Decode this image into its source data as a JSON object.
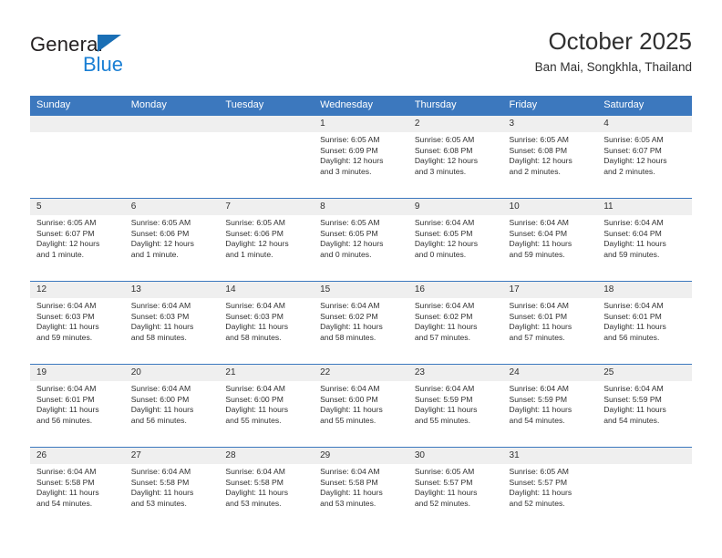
{
  "logo": {
    "word1": "General",
    "word2": "Blue",
    "triangle_color": "#1a6fb5",
    "blue_color": "#1a7fd4"
  },
  "header": {
    "title": "October 2025",
    "subtitle": "Ban Mai, Songkhla, Thailand",
    "accent_color": "#3c78be"
  },
  "calendar": {
    "weekdays": [
      "Sunday",
      "Monday",
      "Tuesday",
      "Wednesday",
      "Thursday",
      "Friday",
      "Saturday"
    ],
    "weeks": [
      [
        {
          "day": "",
          "sunrise": "",
          "sunset": "",
          "daylight1": "",
          "daylight2": ""
        },
        {
          "day": "",
          "sunrise": "",
          "sunset": "",
          "daylight1": "",
          "daylight2": ""
        },
        {
          "day": "",
          "sunrise": "",
          "sunset": "",
          "daylight1": "",
          "daylight2": ""
        },
        {
          "day": "1",
          "sunrise": "Sunrise: 6:05 AM",
          "sunset": "Sunset: 6:09 PM",
          "daylight1": "Daylight: 12 hours",
          "daylight2": "and 3 minutes."
        },
        {
          "day": "2",
          "sunrise": "Sunrise: 6:05 AM",
          "sunset": "Sunset: 6:08 PM",
          "daylight1": "Daylight: 12 hours",
          "daylight2": "and 3 minutes."
        },
        {
          "day": "3",
          "sunrise": "Sunrise: 6:05 AM",
          "sunset": "Sunset: 6:08 PM",
          "daylight1": "Daylight: 12 hours",
          "daylight2": "and 2 minutes."
        },
        {
          "day": "4",
          "sunrise": "Sunrise: 6:05 AM",
          "sunset": "Sunset: 6:07 PM",
          "daylight1": "Daylight: 12 hours",
          "daylight2": "and 2 minutes."
        }
      ],
      [
        {
          "day": "5",
          "sunrise": "Sunrise: 6:05 AM",
          "sunset": "Sunset: 6:07 PM",
          "daylight1": "Daylight: 12 hours",
          "daylight2": "and 1 minute."
        },
        {
          "day": "6",
          "sunrise": "Sunrise: 6:05 AM",
          "sunset": "Sunset: 6:06 PM",
          "daylight1": "Daylight: 12 hours",
          "daylight2": "and 1 minute."
        },
        {
          "day": "7",
          "sunrise": "Sunrise: 6:05 AM",
          "sunset": "Sunset: 6:06 PM",
          "daylight1": "Daylight: 12 hours",
          "daylight2": "and 1 minute."
        },
        {
          "day": "8",
          "sunrise": "Sunrise: 6:05 AM",
          "sunset": "Sunset: 6:05 PM",
          "daylight1": "Daylight: 12 hours",
          "daylight2": "and 0 minutes."
        },
        {
          "day": "9",
          "sunrise": "Sunrise: 6:04 AM",
          "sunset": "Sunset: 6:05 PM",
          "daylight1": "Daylight: 12 hours",
          "daylight2": "and 0 minutes."
        },
        {
          "day": "10",
          "sunrise": "Sunrise: 6:04 AM",
          "sunset": "Sunset: 6:04 PM",
          "daylight1": "Daylight: 11 hours",
          "daylight2": "and 59 minutes."
        },
        {
          "day": "11",
          "sunrise": "Sunrise: 6:04 AM",
          "sunset": "Sunset: 6:04 PM",
          "daylight1": "Daylight: 11 hours",
          "daylight2": "and 59 minutes."
        }
      ],
      [
        {
          "day": "12",
          "sunrise": "Sunrise: 6:04 AM",
          "sunset": "Sunset: 6:03 PM",
          "daylight1": "Daylight: 11 hours",
          "daylight2": "and 59 minutes."
        },
        {
          "day": "13",
          "sunrise": "Sunrise: 6:04 AM",
          "sunset": "Sunset: 6:03 PM",
          "daylight1": "Daylight: 11 hours",
          "daylight2": "and 58 minutes."
        },
        {
          "day": "14",
          "sunrise": "Sunrise: 6:04 AM",
          "sunset": "Sunset: 6:03 PM",
          "daylight1": "Daylight: 11 hours",
          "daylight2": "and 58 minutes."
        },
        {
          "day": "15",
          "sunrise": "Sunrise: 6:04 AM",
          "sunset": "Sunset: 6:02 PM",
          "daylight1": "Daylight: 11 hours",
          "daylight2": "and 58 minutes."
        },
        {
          "day": "16",
          "sunrise": "Sunrise: 6:04 AM",
          "sunset": "Sunset: 6:02 PM",
          "daylight1": "Daylight: 11 hours",
          "daylight2": "and 57 minutes."
        },
        {
          "day": "17",
          "sunrise": "Sunrise: 6:04 AM",
          "sunset": "Sunset: 6:01 PM",
          "daylight1": "Daylight: 11 hours",
          "daylight2": "and 57 minutes."
        },
        {
          "day": "18",
          "sunrise": "Sunrise: 6:04 AM",
          "sunset": "Sunset: 6:01 PM",
          "daylight1": "Daylight: 11 hours",
          "daylight2": "and 56 minutes."
        }
      ],
      [
        {
          "day": "19",
          "sunrise": "Sunrise: 6:04 AM",
          "sunset": "Sunset: 6:01 PM",
          "daylight1": "Daylight: 11 hours",
          "daylight2": "and 56 minutes."
        },
        {
          "day": "20",
          "sunrise": "Sunrise: 6:04 AM",
          "sunset": "Sunset: 6:00 PM",
          "daylight1": "Daylight: 11 hours",
          "daylight2": "and 56 minutes."
        },
        {
          "day": "21",
          "sunrise": "Sunrise: 6:04 AM",
          "sunset": "Sunset: 6:00 PM",
          "daylight1": "Daylight: 11 hours",
          "daylight2": "and 55 minutes."
        },
        {
          "day": "22",
          "sunrise": "Sunrise: 6:04 AM",
          "sunset": "Sunset: 6:00 PM",
          "daylight1": "Daylight: 11 hours",
          "daylight2": "and 55 minutes."
        },
        {
          "day": "23",
          "sunrise": "Sunrise: 6:04 AM",
          "sunset": "Sunset: 5:59 PM",
          "daylight1": "Daylight: 11 hours",
          "daylight2": "and 55 minutes."
        },
        {
          "day": "24",
          "sunrise": "Sunrise: 6:04 AM",
          "sunset": "Sunset: 5:59 PM",
          "daylight1": "Daylight: 11 hours",
          "daylight2": "and 54 minutes."
        },
        {
          "day": "25",
          "sunrise": "Sunrise: 6:04 AM",
          "sunset": "Sunset: 5:59 PM",
          "daylight1": "Daylight: 11 hours",
          "daylight2": "and 54 minutes."
        }
      ],
      [
        {
          "day": "26",
          "sunrise": "Sunrise: 6:04 AM",
          "sunset": "Sunset: 5:58 PM",
          "daylight1": "Daylight: 11 hours",
          "daylight2": "and 54 minutes."
        },
        {
          "day": "27",
          "sunrise": "Sunrise: 6:04 AM",
          "sunset": "Sunset: 5:58 PM",
          "daylight1": "Daylight: 11 hours",
          "daylight2": "and 53 minutes."
        },
        {
          "day": "28",
          "sunrise": "Sunrise: 6:04 AM",
          "sunset": "Sunset: 5:58 PM",
          "daylight1": "Daylight: 11 hours",
          "daylight2": "and 53 minutes."
        },
        {
          "day": "29",
          "sunrise": "Sunrise: 6:04 AM",
          "sunset": "Sunset: 5:58 PM",
          "daylight1": "Daylight: 11 hours",
          "daylight2": "and 53 minutes."
        },
        {
          "day": "30",
          "sunrise": "Sunrise: 6:05 AM",
          "sunset": "Sunset: 5:57 PM",
          "daylight1": "Daylight: 11 hours",
          "daylight2": "and 52 minutes."
        },
        {
          "day": "31",
          "sunrise": "Sunrise: 6:05 AM",
          "sunset": "Sunset: 5:57 PM",
          "daylight1": "Daylight: 11 hours",
          "daylight2": "and 52 minutes."
        },
        {
          "day": "",
          "sunrise": "",
          "sunset": "",
          "daylight1": "",
          "daylight2": ""
        }
      ]
    ]
  }
}
